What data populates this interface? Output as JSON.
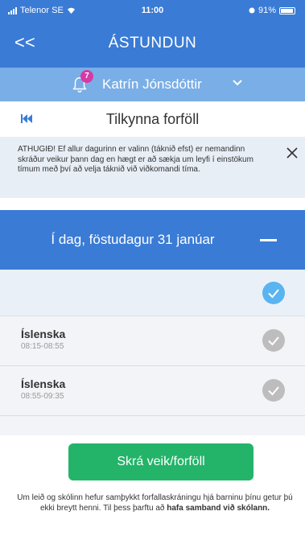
{
  "status": {
    "carrier": "Telenor SE",
    "time": "11:00",
    "battery": "91%"
  },
  "nav": {
    "back_label": "<<",
    "title": "ÁSTUNDUN"
  },
  "user": {
    "notification_count": "7",
    "name": "Katrín Jónsdóttir"
  },
  "subheader": {
    "title": "Tilkynna forföll"
  },
  "notice": {
    "text": "ATHUGIÐ! Ef allur dagurinn er valinn (táknið efst) er nemandinn skráður veikur þann dag en hægt er að sækja um leyfi í einstökum tímum með því að velja táknið við viðkomandi tíma."
  },
  "day": {
    "title": "Í dag, föstudagur 31 janúar"
  },
  "lessons": [
    {
      "subject": "Íslenska",
      "time": "08:15-08:55"
    },
    {
      "subject": "Íslenska",
      "time": "08:55-09:35"
    }
  ],
  "button": {
    "label": "Skrá veik/forföll"
  },
  "footer": {
    "text_before": "Um leið og skólinn hefur samþykkt forfallaskráningu hjá barninu þínu getur þú ekki breytt henni. Til þess þarftu að ",
    "text_bold": "hafa samband við skólann."
  },
  "colors": {
    "primary": "#3a7bd5",
    "user_bar": "#79aee6",
    "badge": "#d63aa5",
    "check_active": "#5ab4ef",
    "check_inactive": "#bdbdbd",
    "button": "#23b46a"
  }
}
